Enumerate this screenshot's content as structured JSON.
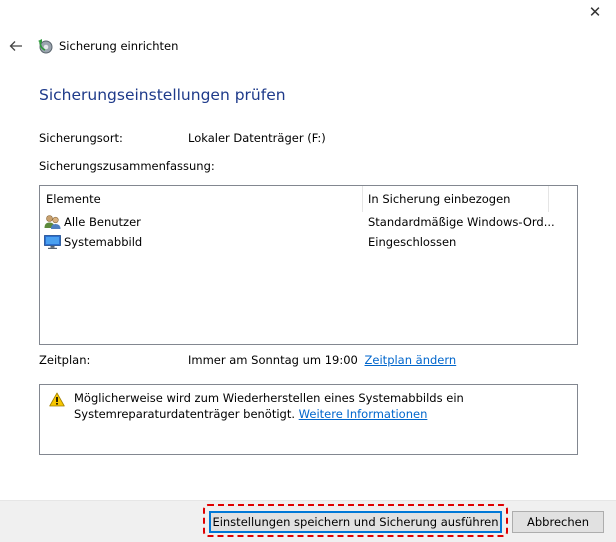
{
  "window": {
    "close_glyph": "✕"
  },
  "header": {
    "title": "Sicherung einrichten",
    "back_icon": "back-arrow-icon",
    "app_icon": "backup-icon"
  },
  "page": {
    "title": "Sicherungseinstellungen prüfen"
  },
  "backup_location": {
    "label": "Sicherungsort:",
    "value": "Lokaler Datenträger (F:)"
  },
  "summary": {
    "label": "Sicherungszusammenfassung:",
    "columns": [
      "Elemente",
      "In Sicherung einbezogen"
    ],
    "rows": [
      {
        "icon": "users-icon",
        "name": "Alle Benutzer",
        "value": "Standardmäßige Windows-Ord..."
      },
      {
        "icon": "monitor-icon",
        "name": "Systemabbild",
        "value": "Eingeschlossen"
      }
    ]
  },
  "schedule": {
    "label": "Zeitplan:",
    "value": "Immer am Sonntag um 19:00",
    "change_link": "Zeitplan ändern"
  },
  "warning": {
    "icon": "warning-icon",
    "text": "Möglicherweise wird zum Wiederherstellen eines Systemabbilds ein Systemreparaturdatenträger benötigt.",
    "link": "Weitere Informationen"
  },
  "footer": {
    "primary_label": "Einstellungen speichern und Sicherung ausführen",
    "cancel_label": "Abbrechen"
  },
  "colors": {
    "title_blue": "#1e3a8a",
    "link_blue": "#0066cc",
    "highlight_red": "#e00000",
    "footer_bg": "#f0f0f0"
  }
}
